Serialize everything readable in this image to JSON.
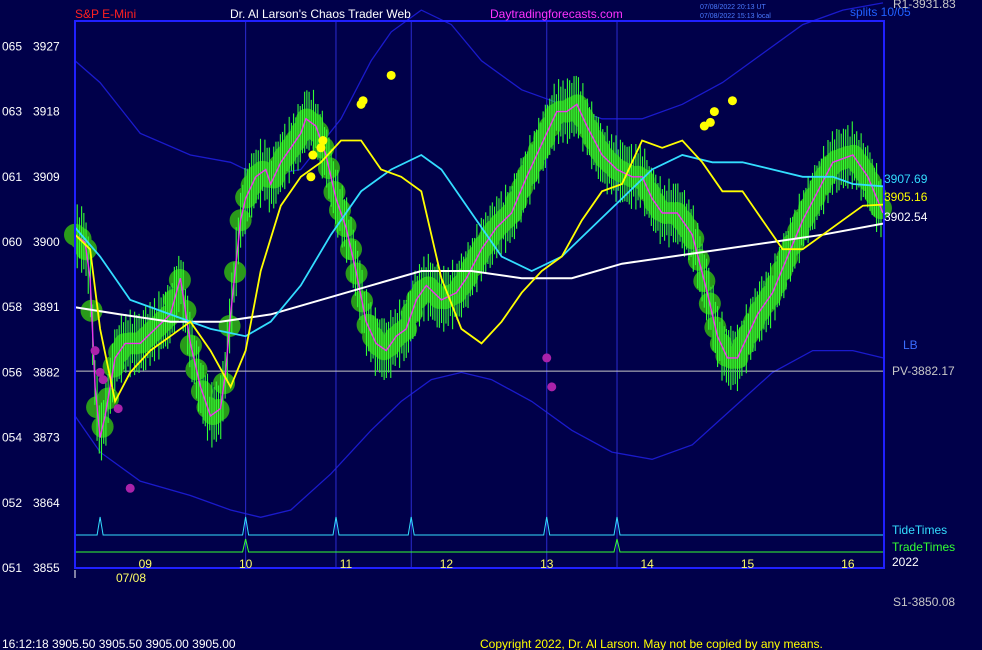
{
  "header": {
    "instrument": "S&P E-Mini",
    "site": "Dr. Al Larson's Chaos Trader Web",
    "url": "Daytradingforecasts.com",
    "timestamp_ut": "07/08/2022 20:13 UT",
    "timestamp_local": "07/08/2022 15:13 local",
    "right_label": "splits 10/05",
    "r1": "R1-3931.83"
  },
  "footer": {
    "quote": "16:12:18  3905.50 3905.50 3905.00 3905.00",
    "copyright": "Copyright 2022, Dr. Al Larson. May not be copied by any means.",
    "s1": "S1-3850.08"
  },
  "colors": {
    "background": "#00004a",
    "frame": "#2020ff",
    "price": "#33ff33",
    "ribbon": "#2a9a1a",
    "yellow_ma": "#ffff00",
    "cyan_ma": "#33ddff",
    "white_ma": "#ffffff",
    "band": "#1a1acc",
    "magenta": "#ee33ee",
    "marker_high": "#ffff00",
    "marker_low": "#aa22aa",
    "tide": "#33ddff",
    "trade": "#33ff33"
  },
  "chart_data": {
    "type": "line",
    "date_label": "07/08",
    "year_label": "2022",
    "ylim": [
      3855,
      3930.5
    ],
    "xlim": [
      8.05,
      16.11
    ],
    "y_axis_ticks": [
      {
        "left": "065",
        "right": "3927",
        "value": 3927
      },
      {
        "left": "063",
        "right": "3918",
        "value": 3918
      },
      {
        "left": "061",
        "right": "3909",
        "value": 3909
      },
      {
        "left": "060",
        "right": "3900",
        "value": 3900
      },
      {
        "left": "058",
        "right": "3891",
        "value": 3891
      },
      {
        "left": "056",
        "right": "3882",
        "value": 3882
      },
      {
        "left": "054",
        "right": "3873",
        "value": 3873
      },
      {
        "left": "052",
        "right": "3864",
        "value": 3864
      },
      {
        "left": "051",
        "right": "3855",
        "value": 3855
      }
    ],
    "x_axis_ticks": [
      {
        "label": "09",
        "value": 8.75
      },
      {
        "label": "10",
        "value": 9.75
      },
      {
        "label": "11",
        "value": 10.75
      },
      {
        "label": "12",
        "value": 11.75
      },
      {
        "label": "13",
        "value": 12.75
      },
      {
        "label": "14",
        "value": 13.75
      },
      {
        "label": "15",
        "value": 14.75
      },
      {
        "label": "16",
        "value": 15.75
      }
    ],
    "vertical_lines": [
      9.75,
      10.65,
      11.4,
      12.75,
      13.45
    ],
    "pivot": {
      "label": "PV-3882.17",
      "value": 3882.17
    },
    "band_label": "LB",
    "value_labels": [
      {
        "text": "3907.69",
        "value": 3907.69,
        "series": "cyan_ma"
      },
      {
        "text": "3905.16",
        "value": 3905.16,
        "series": "yellow_ma"
      },
      {
        "text": "3902.54",
        "value": 3902.54,
        "series": "white_ma"
      }
    ],
    "event_rows": [
      {
        "label": "TideTimes",
        "x": [
          8.3,
          9.75,
          10.65,
          11.4,
          12.75,
          13.45
        ]
      },
      {
        "label": "TradeTimes",
        "x": [
          9.75,
          13.45
        ]
      }
    ],
    "series": [
      {
        "name": "price",
        "x": [
          8.05,
          8.15,
          8.2,
          8.25,
          8.3,
          8.35,
          8.45,
          8.55,
          8.7,
          8.85,
          9.0,
          9.1,
          9.2,
          9.3,
          9.4,
          9.5,
          9.55,
          9.6,
          9.7,
          9.75,
          9.85,
          9.95,
          10.0,
          10.1,
          10.2,
          10.3,
          10.35,
          10.45,
          10.55,
          10.65,
          10.75,
          10.85,
          10.95,
          11.05,
          11.15,
          11.25,
          11.35,
          11.45,
          11.55,
          11.7,
          11.85,
          11.95,
          12.1,
          12.25,
          12.4,
          12.55,
          12.65,
          12.75,
          12.85,
          12.95,
          13.05,
          13.15,
          13.3,
          13.45,
          13.6,
          13.7,
          13.8,
          13.9,
          14.05,
          14.2,
          14.35,
          14.45,
          14.55,
          14.65,
          14.75,
          14.85,
          15.0,
          15.15,
          15.3,
          15.45,
          15.6,
          15.8,
          15.95,
          16.1
        ],
        "y": [
          3901,
          3900,
          3895,
          3880,
          3873,
          3876,
          3884,
          3886,
          3886,
          3888,
          3890,
          3895,
          3886,
          3880,
          3876,
          3877,
          3882,
          3890,
          3903,
          3906,
          3909,
          3910,
          3908,
          3911,
          3913,
          3915,
          3917,
          3916,
          3912,
          3906,
          3902,
          3896,
          3889,
          3886,
          3885,
          3887,
          3888,
          3892,
          3894,
          3892,
          3893,
          3895,
          3899,
          3902,
          3904,
          3909,
          3912,
          3915,
          3918,
          3918,
          3919,
          3916,
          3912,
          3910,
          3909,
          3909,
          3906,
          3904,
          3904,
          3901,
          3893,
          3887,
          3884,
          3884,
          3887,
          3890,
          3893,
          3898,
          3903,
          3907,
          3911,
          3912,
          3909,
          3904
        ]
      },
      {
        "name": "yellow_ma",
        "x": [
          8.05,
          8.2,
          8.3,
          8.45,
          8.6,
          8.8,
          9.0,
          9.2,
          9.4,
          9.6,
          9.75,
          9.9,
          10.1,
          10.3,
          10.5,
          10.7,
          10.9,
          11.1,
          11.3,
          11.5,
          11.7,
          11.9,
          12.1,
          12.3,
          12.5,
          12.7,
          12.9,
          13.1,
          13.3,
          13.5,
          13.7,
          13.9,
          14.1,
          14.3,
          14.5,
          14.7,
          14.9,
          15.1,
          15.3,
          15.5,
          15.7,
          15.9,
          16.1
        ],
        "y": [
          3901,
          3899,
          3888,
          3878,
          3882,
          3885,
          3887,
          3889,
          3885,
          3880,
          3885,
          3896,
          3905,
          3909,
          3911,
          3914,
          3914,
          3910,
          3909,
          3907,
          3895,
          3888,
          3886,
          3889,
          3893,
          3896,
          3898,
          3903,
          3907,
          3908,
          3914,
          3913,
          3914,
          3911,
          3907,
          3907,
          3903,
          3899,
          3899,
          3901,
          3903,
          3905,
          3905.16
        ]
      },
      {
        "name": "cyan_ma",
        "x": [
          8.05,
          8.3,
          8.6,
          9.0,
          9.4,
          9.75,
          10.0,
          10.3,
          10.6,
          10.9,
          11.2,
          11.5,
          11.7,
          12.0,
          12.3,
          12.6,
          12.9,
          13.2,
          13.5,
          13.8,
          14.1,
          14.4,
          14.7,
          15.0,
          15.3,
          15.6,
          15.8,
          16.1
        ],
        "y": [
          3902,
          3898,
          3892,
          3890,
          3888,
          3887,
          3889,
          3894,
          3901,
          3907,
          3910,
          3912,
          3910,
          3904,
          3898,
          3896,
          3898,
          3902,
          3906,
          3910,
          3912,
          3911,
          3911,
          3910,
          3909,
          3909,
          3908,
          3907.69
        ]
      },
      {
        "name": "white_ma",
        "x": [
          8.05,
          8.5,
          9.0,
          9.5,
          10.0,
          10.5,
          11.0,
          11.5,
          12.0,
          12.5,
          13.0,
          13.5,
          14.0,
          14.5,
          15.0,
          15.5,
          16.1
        ],
        "y": [
          3891,
          3890,
          3889,
          3889,
          3890,
          3892,
          3894,
          3896,
          3896,
          3895,
          3895,
          3897,
          3898,
          3899,
          3900,
          3901,
          3902.54
        ]
      },
      {
        "name": "upper_band",
        "x": [
          8.05,
          8.3,
          8.7,
          9.2,
          9.6,
          9.9,
          10.3,
          10.7,
          11.0,
          11.2,
          11.5,
          11.8,
          12.1,
          12.5,
          12.9,
          13.3,
          13.7,
          14.1,
          14.5,
          14.9,
          15.3,
          15.7,
          16.1
        ],
        "y": [
          3925,
          3922,
          3915,
          3912,
          3911,
          3909,
          3910,
          3917,
          3925,
          3929,
          3932,
          3930,
          3925,
          3921,
          3919,
          3917,
          3917,
          3919,
          3922,
          3926,
          3930,
          3932,
          3933
        ]
      },
      {
        "name": "lower_band",
        "x": [
          8.05,
          8.3,
          8.7,
          9.2,
          9.6,
          9.9,
          10.2,
          10.6,
          11.0,
          11.3,
          11.6,
          11.9,
          12.2,
          12.6,
          13.0,
          13.4,
          13.8,
          14.2,
          14.6,
          15.0,
          15.4,
          15.8,
          16.1
        ],
        "y": [
          3876,
          3871,
          3867,
          3865,
          3863,
          3862,
          3863,
          3868,
          3874,
          3878,
          3881,
          3882,
          3881,
          3878,
          3874,
          3871,
          3870,
          3872,
          3877,
          3882,
          3885,
          3885,
          3884
        ]
      }
    ],
    "high_markers": {
      "x": [
        10.4,
        10.42,
        10.5,
        10.52,
        10.9,
        10.92,
        11.2,
        14.32,
        14.38,
        14.42,
        14.6
      ],
      "y": [
        3909,
        3912,
        3913,
        3914,
        3919,
        3919.5,
        3923,
        3916,
        3916.5,
        3918,
        3919.5
      ]
    },
    "low_markers": {
      "x": [
        8.25,
        8.3,
        8.33,
        8.48,
        8.6,
        12.75,
        12.8
      ],
      "y": [
        3885,
        3882,
        3881,
        3877,
        3866,
        3884,
        3880
      ]
    }
  }
}
